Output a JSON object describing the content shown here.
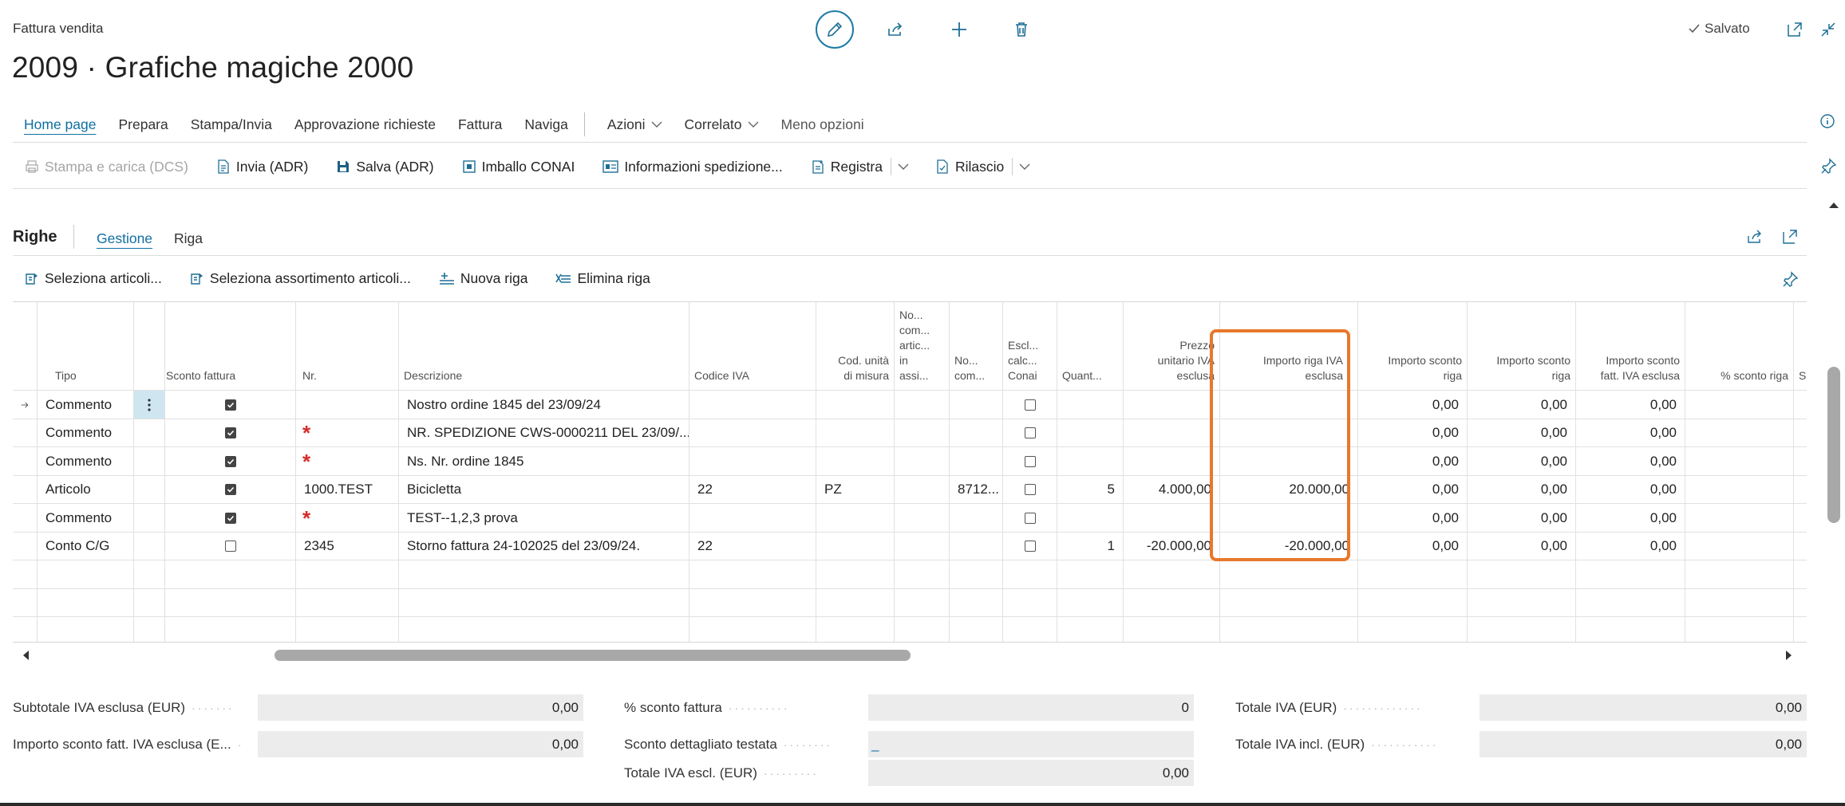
{
  "header": {
    "caption": "Fattura vendita",
    "title": "2009 · Grafiche magiche 2000",
    "saved_label": "Salvato"
  },
  "nav": {
    "items": [
      "Home page",
      "Prepara",
      "Stampa/Invia",
      "Approvazione richieste",
      "Fattura",
      "Naviga"
    ],
    "dropdowns": [
      "Azioni",
      "Correlato"
    ],
    "less_options": "Meno opzioni"
  },
  "actions": {
    "print_upload": "Stampa e carica (DCS)",
    "send_adr": "Invia (ADR)",
    "save_adr": "Salva (ADR)",
    "conai": "Imballo CONAI",
    "shipping_info": "Informazioni spedizione...",
    "post": "Registra",
    "release": "Rilascio"
  },
  "lines": {
    "title": "Righe",
    "tabs": [
      "Gestione",
      "Riga"
    ],
    "actions": [
      "Seleziona articoli...",
      "Seleziona assortimento articoli...",
      "Nuova riga",
      "Elimina riga"
    ],
    "columns": {
      "tipo": "Tipo",
      "sconto_fattura": "Sconto fattura",
      "nr": "Nr.",
      "descrizione": "Descrizione",
      "codice_iva": "Codice IVA",
      "cod_unita_1": "Cod. unità",
      "cod_unita_2": "di misura",
      "no_com_1": "No...",
      "no_com_2": "com...",
      "no_com_3": "artic...",
      "no_com_4": "in",
      "no_com_5": "assi...",
      "no2_1": "No...",
      "no2_2": "com...",
      "esci_1": "Escl...",
      "esci_2": "calc...",
      "esci_3": "Conai",
      "quantita": "Quant...",
      "prezzo_1": "Prezzo",
      "prezzo_2": "unitario IVA",
      "prezzo_3": "esclusa",
      "importo_riga_1": "Importo riga IVA",
      "importo_riga_2": "esclusa",
      "sconto_riga_1": "Importo sconto",
      "sconto_riga_2": "riga",
      "sconto_riga2_1": "Importo sconto",
      "sconto_riga2_2": "riga",
      "sconto_fatt_1": "Importo sconto",
      "sconto_fatt_2": "fatt. IVA esclusa",
      "perc_sconto": "% sconto riga",
      "sco": "Sco"
    },
    "rows": [
      {
        "tipo": "Commento",
        "sconto": true,
        "nr": "",
        "star": false,
        "descrizione": "Nostro ordine 1845 del 23/09/24",
        "codice_iva": "",
        "um": "",
        "no_com": "",
        "escl": false,
        "qta": "",
        "prezzo": "",
        "importo": "",
        "sconto_riga": "0,00",
        "sconto_riga2": "0,00",
        "sconto_fatt": "0,00"
      },
      {
        "tipo": "Commento",
        "sconto": true,
        "nr": "",
        "star": true,
        "descrizione": "NR. SPEDIZIONE CWS-0000211 DEL 23/09/...",
        "codice_iva": "",
        "um": "",
        "no_com": "",
        "escl": false,
        "qta": "",
        "prezzo": "",
        "importo": "",
        "sconto_riga": "0,00",
        "sconto_riga2": "0,00",
        "sconto_fatt": "0,00"
      },
      {
        "tipo": "Commento",
        "sconto": true,
        "nr": "",
        "star": true,
        "descrizione": "Ns. Nr. ordine 1845",
        "codice_iva": "",
        "um": "",
        "no_com": "",
        "escl": false,
        "qta": "",
        "prezzo": "",
        "importo": "",
        "sconto_riga": "0,00",
        "sconto_riga2": "0,00",
        "sconto_fatt": "0,00"
      },
      {
        "tipo": "Articolo",
        "sconto": true,
        "nr": "1000.TEST",
        "star": false,
        "descrizione": "Bicicletta",
        "codice_iva": "22",
        "um": "PZ",
        "no_com": "8712...",
        "escl": false,
        "qta": "5",
        "prezzo": "4.000,00",
        "importo": "20.000,00",
        "sconto_riga": "0,00",
        "sconto_riga2": "0,00",
        "sconto_fatt": "0,00"
      },
      {
        "tipo": "Commento",
        "sconto": true,
        "nr": "",
        "star": true,
        "descrizione": "TEST--1,2,3 prova",
        "codice_iva": "",
        "um": "",
        "no_com": "",
        "escl": false,
        "qta": "",
        "prezzo": "",
        "importo": "",
        "sconto_riga": "0,00",
        "sconto_riga2": "0,00",
        "sconto_fatt": "0,00"
      },
      {
        "tipo": "Conto C/G",
        "sconto": false,
        "nr": "2345",
        "star": false,
        "descrizione": "Storno fattura 24-102025 del 23/09/24.",
        "codice_iva": "22",
        "um": "",
        "no_com": "",
        "escl": false,
        "qta": "1",
        "prezzo": "-20.000,00",
        "importo": "-20.000,00",
        "sconto_riga": "0,00",
        "sconto_riga2": "0,00",
        "sconto_fatt": "0,00"
      }
    ]
  },
  "totals": {
    "subtotale_label": "Subtotale IVA esclusa (EUR)",
    "subtotale_value": "0,00",
    "importo_sconto_label": "Importo sconto fatt. IVA esclusa (E...",
    "importo_sconto_value": "0,00",
    "perc_sconto_label": "% sconto fattura",
    "perc_sconto_value": "0",
    "sconto_dett_label": "Sconto dettagliato testata",
    "sconto_dett_value": "_",
    "totale_iva_escl_label": "Totale IVA escl. (EUR)",
    "totale_iva_escl_value": "0,00",
    "totale_iva_label": "Totale IVA (EUR)",
    "totale_iva_value": "0,00",
    "totale_iva_incl_label": "Totale IVA incl. (EUR)",
    "totale_iva_incl_value": "0,00"
  },
  "colors": {
    "accent": "#0f6fa3",
    "highlight": "#e8782b",
    "required_star": "#d62b2b"
  }
}
